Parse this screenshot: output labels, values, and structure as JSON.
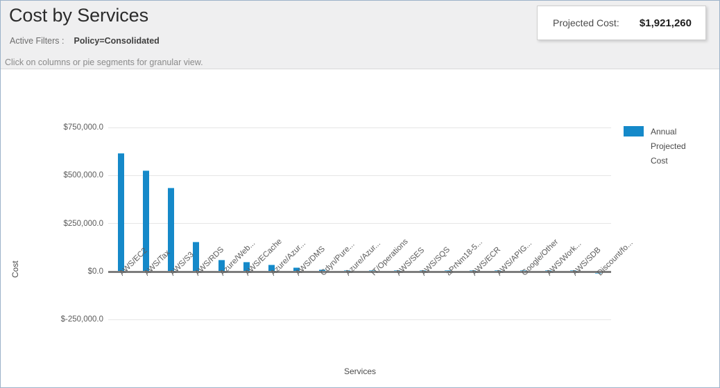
{
  "header": {
    "title": "Cost by Services",
    "filters_label": "Active Filters :",
    "filters_value": "Policy=Consolidated",
    "hint": "Click on columns or pie segments for granular view.",
    "cost_card": {
      "label": "Projected Cost:",
      "value": "$1,921,260"
    }
  },
  "colors": {
    "bar": "#1589c9",
    "bar_top": "#69bce5",
    "header_bg": "#efeff0",
    "frame_border": "#9bb2c9",
    "gridline": "#e6e6e6",
    "baseline": "#7d7d7d",
    "text": "#5b5b5b"
  },
  "legend": {
    "position": "right",
    "entries": [
      {
        "label": "Annual Projected Cost",
        "color": "#1589c9"
      }
    ]
  },
  "chart_data": {
    "type": "bar",
    "title": "Cost by Services",
    "xlabel": "Services",
    "ylabel": "Cost",
    "ylim": [
      -250000,
      750000
    ],
    "ytick_labels": [
      "$750,000.0",
      "$500,000.0",
      "$250,000.0",
      "$0.0",
      "$-250,000.0"
    ],
    "ytick_values": [
      750000,
      500000,
      250000,
      0,
      -250000
    ],
    "grid": true,
    "series_name": "Annual Projected Cost",
    "categories": [
      "AWS/EC2",
      "AWS/Tax",
      "AWS/S3",
      "AWS/RDS",
      "Azure/Web...",
      "AWS/ECache",
      "Azure/Azur...",
      "AWS/DMS",
      "Cdyn/Pure...",
      "Azure/Azur...",
      "IT/Operations",
      "AWS/SES",
      "AWS/SQS",
      "aPrNm18-5...",
      "AWS/ECR",
      "AWS/APIG...",
      "Google/Other",
      "AWS/Work...",
      "AWS/SDB",
      "Discount/fo..."
    ],
    "values": [
      616000,
      525000,
      438000,
      156000,
      62000,
      51000,
      36000,
      22000,
      12000,
      9000,
      8000,
      7000,
      6000,
      5000,
      4500,
      4000,
      3500,
      3000,
      2500,
      -12000
    ]
  }
}
